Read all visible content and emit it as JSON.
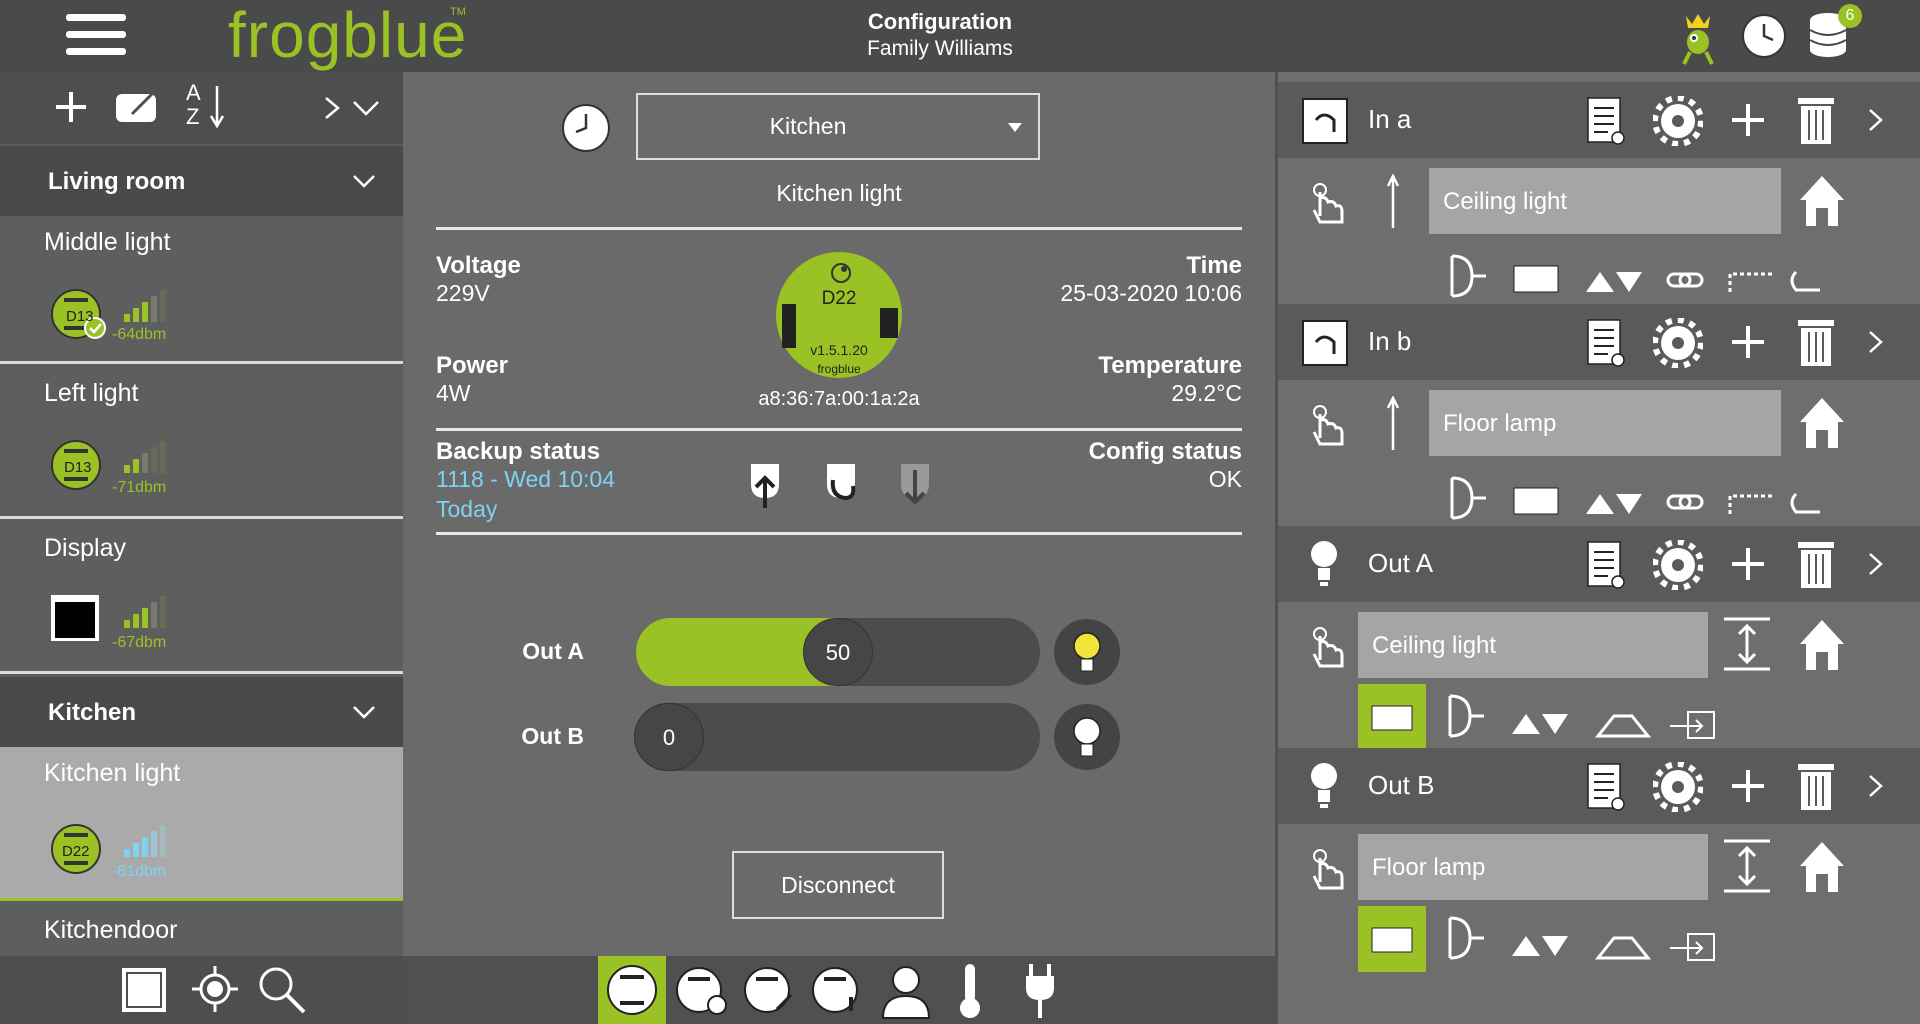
{
  "header": {
    "logo": "frogblue",
    "logo_tm": "TM",
    "title": "Configuration",
    "subtitle": "Family Williams",
    "db_badge": "6"
  },
  "sidebar": {
    "toolbar": {
      "sort_top": "A",
      "sort_bottom": "Z"
    },
    "groups": [
      {
        "name": "Living room",
        "devices": [
          {
            "name": "Middle light",
            "chip": "D13",
            "signal": "-64dbm"
          },
          {
            "name": "Left light",
            "chip": "D13",
            "signal": "-71dbm"
          },
          {
            "name": "Display",
            "signal": "-67dbm"
          }
        ]
      },
      {
        "name": "Kitchen",
        "devices": [
          {
            "name": "Kitchen light",
            "chip": "D22",
            "signal": "-61dbm"
          },
          {
            "name": "Kitchendoor"
          }
        ]
      }
    ]
  },
  "center": {
    "room_select": "Kitchen",
    "device_title": "Kitchen light",
    "voltage_label": "Voltage",
    "voltage_value": "229V",
    "power_label": "Power",
    "power_value": "4W",
    "time_label": "Time",
    "time_value": "25-03-2020 10:06",
    "temp_label": "Temperature",
    "temp_value": "29.2°C",
    "chip": {
      "model": "D22",
      "version": "v1.5.1.20",
      "brand": "frogblue"
    },
    "mac": "a8:36:7a:00:1a:2a",
    "backup_label": "Backup status",
    "backup_value": "1118 - Wed 10:04",
    "backup_day": "Today",
    "config_label": "Config status",
    "config_value": "OK",
    "outputs": [
      {
        "label": "Out A",
        "value": "50",
        "level": 50
      },
      {
        "label": "Out B",
        "value": "0",
        "level": 0
      }
    ],
    "disconnect": "Disconnect"
  },
  "right": {
    "inputs": [
      {
        "name": "In a",
        "target": "Ceiling light"
      },
      {
        "name": "In b",
        "target": "Floor lamp"
      }
    ],
    "outputs": [
      {
        "name": "Out A",
        "target": "Ceiling light"
      },
      {
        "name": "Out B",
        "target": "Floor lamp"
      }
    ]
  },
  "colors": {
    "accent": "#9bc224",
    "link": "#7fd3f0",
    "panel": "#6a6a6a",
    "bulb_on": "#f2e23a"
  }
}
